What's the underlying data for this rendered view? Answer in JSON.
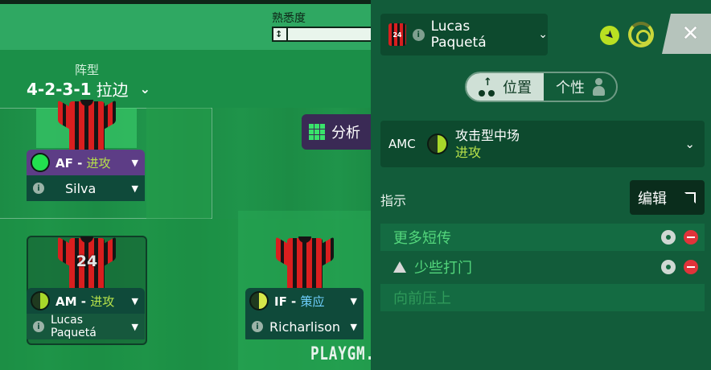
{
  "pitch": {
    "familiarity_label": "熟悉度",
    "formation_label": "阵型",
    "formation_code": "4-2-3-1",
    "formation_variant": "拉边",
    "analysis_label": "分析",
    "watermark": "PLAYGM.CN"
  },
  "players": [
    {
      "role": "AF",
      "sep": " - ",
      "duty": "进攻",
      "name": "Silva",
      "role_color": "#5d3d86",
      "circle_color": "#22e04f",
      "number": ""
    },
    {
      "role": "AM",
      "sep": " - ",
      "duty": "进攻",
      "name": "Lucas Paquetá",
      "role_color": "#0f4a3a",
      "circle_color": "#a8d82a",
      "number": "24"
    },
    {
      "role": "IF",
      "sep": " - ",
      "duty": "策应",
      "name": "Richarlison",
      "role_color": "#0f4a3a",
      "circle_color": "#d6e84a",
      "number": ""
    }
  ],
  "panel": {
    "player_name": "Lucas Paquetá",
    "shirt_number": "24",
    "toggle_position": "位置",
    "toggle_personality": "个性",
    "role_code": "AMC",
    "role_name": "攻击型中场",
    "role_duty": "进攻",
    "instructions_label": "指示",
    "edit_label": "编辑",
    "instructions": [
      {
        "text": "更多短传",
        "warning": false,
        "actions": true
      },
      {
        "text": "少些打门",
        "warning": true,
        "actions": true
      },
      {
        "text": "向前压上",
        "warning": false,
        "actions": false
      }
    ]
  },
  "colors": {
    "accent_green": "#53d67c",
    "duty_green": "#b7e24a",
    "remove_red": "#e0333a"
  }
}
